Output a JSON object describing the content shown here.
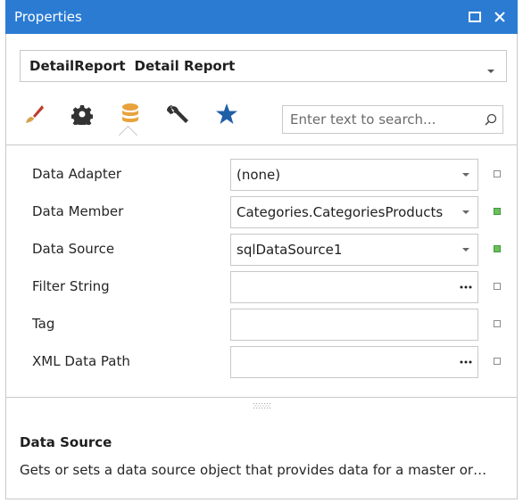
{
  "window": {
    "title": "Properties"
  },
  "selector": {
    "name": "DetailReport",
    "type": "Detail Report"
  },
  "toolbar": {
    "tools": [
      {
        "icon": "paintbrush-icon",
        "color": "#c0392b"
      },
      {
        "icon": "gear-icon",
        "color": "#333333"
      },
      {
        "icon": "database-icon",
        "color": "#e8a33d"
      },
      {
        "icon": "wrench-icon",
        "color": "#333333"
      },
      {
        "icon": "star-icon",
        "color": "#1f5fa8"
      }
    ],
    "active_tool": "database-icon",
    "search_placeholder": "Enter text to search..."
  },
  "properties": [
    {
      "label": "Data Adapter",
      "value": "(none)",
      "editor": "dropdown",
      "modified": false
    },
    {
      "label": "Data Member",
      "value": "Categories.CategoriesProducts",
      "editor": "dropdown",
      "modified": true
    },
    {
      "label": "Data Source",
      "value": "sqlDataSource1",
      "editor": "dropdown",
      "modified": true
    },
    {
      "label": "Filter String",
      "value": "",
      "editor": "ellipsis",
      "modified": false
    },
    {
      "label": "Tag",
      "value": "",
      "editor": "text",
      "modified": false
    },
    {
      "label": "XML Data Path",
      "value": "",
      "editor": "ellipsis",
      "modified": false
    }
  ],
  "description": {
    "title": "Data Source",
    "text": "Gets or sets a data source object that provides data for a master or…"
  },
  "colors": {
    "accent": "#2b7bd3",
    "modified_marker": "#6bbf59"
  }
}
